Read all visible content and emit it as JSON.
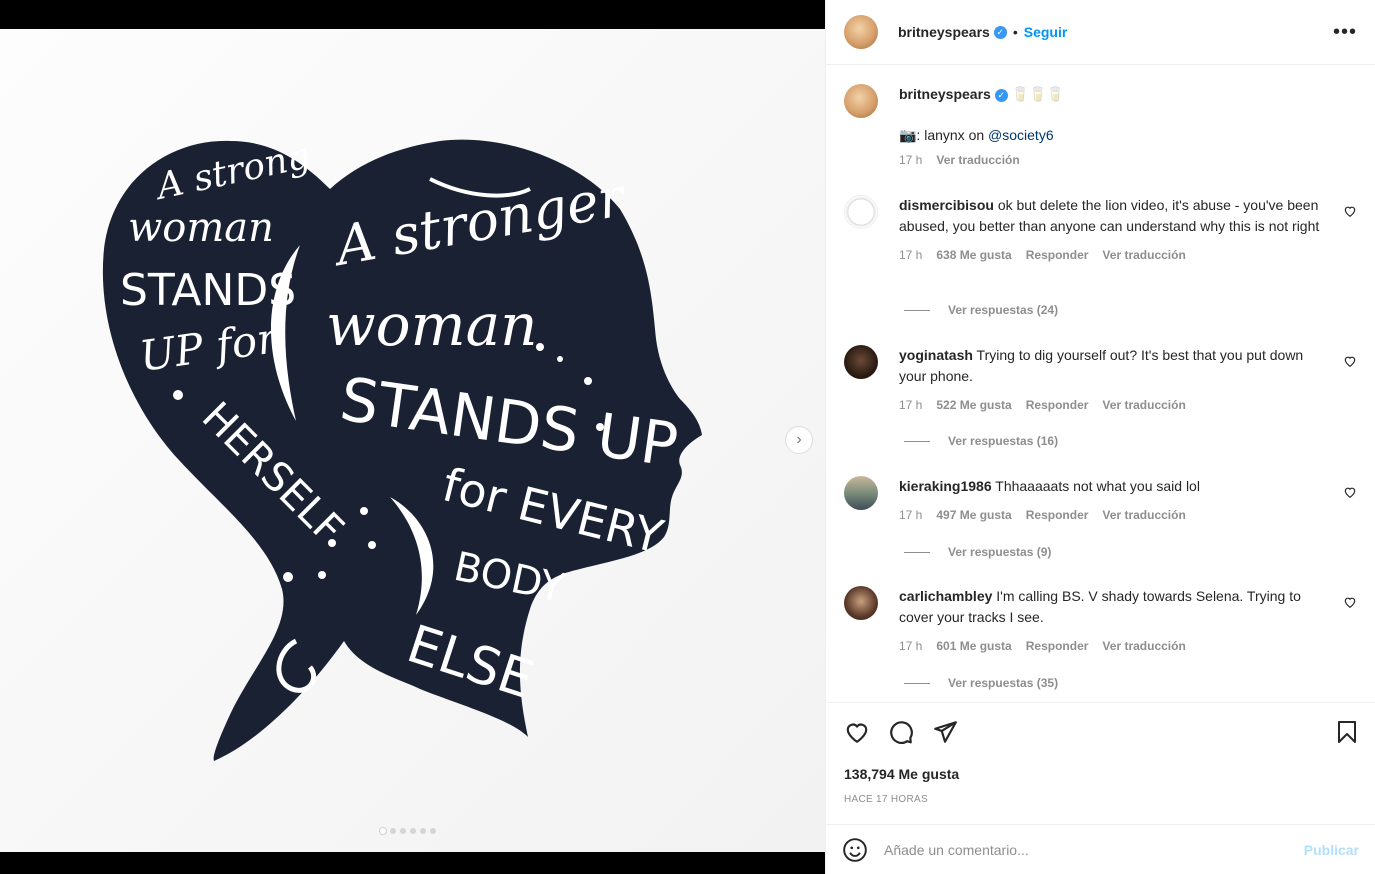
{
  "post": {
    "username": "britneyspears",
    "follow_label": "Seguir",
    "bullet": "•",
    "more_label": "•••",
    "caption_emoji": "🥛🥛🥛",
    "credit_prefix": "📷: lanynx on ",
    "credit_mention": "@society6",
    "caption_time": "17 h",
    "translate_label": "Ver traducción",
    "image_text": {
      "left": [
        "A strong",
        "woman",
        "STANDS",
        "UP for",
        "HERSELF"
      ],
      "right": [
        "A stronger",
        "woman",
        "STANDS UP",
        "for EVERY",
        "BODY",
        "ELSE"
      ]
    }
  },
  "comments": [
    {
      "username": "dismercibisou",
      "text": "ok but delete the lion video, it's abuse - you've been abused, you better than anyone can understand why this is not right",
      "time": "17 h",
      "likes": "638 Me gusta",
      "reply": "Responder",
      "translate": "Ver traducción",
      "replies": "Ver respuestas (24)"
    },
    {
      "username": "yoginatash",
      "text": "Trying to dig yourself out? It's best that you put down your phone.",
      "time": "17 h",
      "likes": "522 Me gusta",
      "reply": "Responder",
      "translate": "Ver traducción",
      "replies": "Ver respuestas (16)"
    },
    {
      "username": "kieraking1986",
      "text": "Thhaaaaats not what you said lol",
      "time": "17 h",
      "likes": "497 Me gusta",
      "reply": "Responder",
      "translate": "Ver traducción",
      "replies": "Ver respuestas (9)"
    },
    {
      "username": "carlichambley",
      "text": "I'm calling BS. V shady towards Selena. Trying to cover your tracks I see.",
      "time": "17 h",
      "likes": "601 Me gusta",
      "reply": "Responder",
      "translate": "Ver traducción",
      "replies": "Ver respuestas (35)"
    }
  ],
  "stats": {
    "likes": "138,794 Me gusta",
    "posted": "HACE 17 HORAS"
  },
  "compose": {
    "placeholder": "Añade un comentario...",
    "publish_label": "Publicar"
  },
  "carousel": {
    "count": 6,
    "active_index": 0
  },
  "colors": {
    "accent": "#0095f6",
    "verified": "#3897f0",
    "silhouette": "#1a2133"
  }
}
